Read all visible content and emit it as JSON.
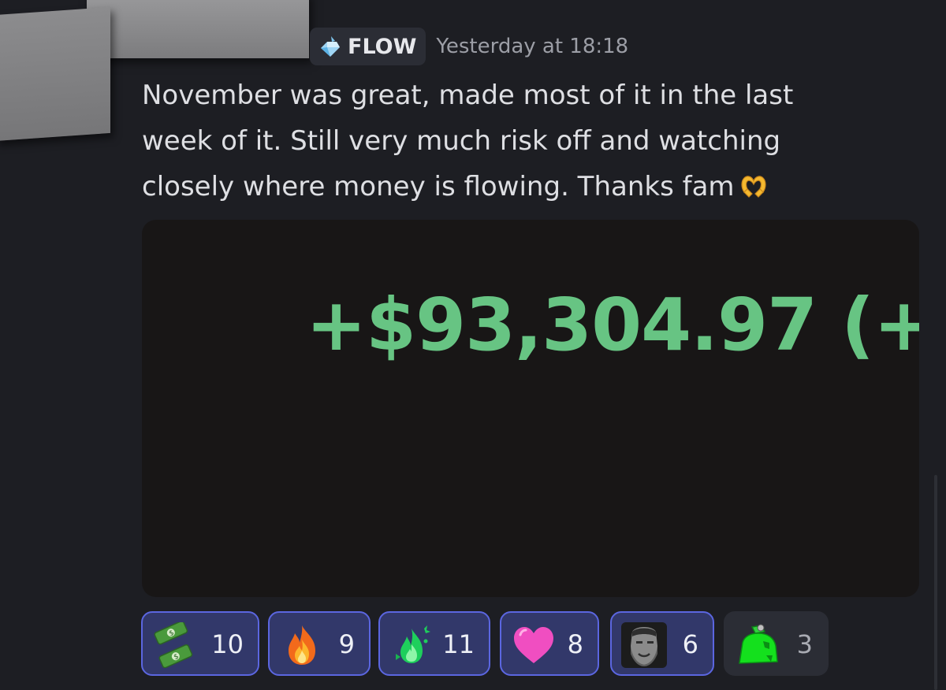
{
  "message": {
    "author_role": "FLOW",
    "role_icon": "blue-diamond-icon",
    "timestamp": "Yesterday at 18:18",
    "lines": [
      "November was great, made most of it in the last",
      "week of it. Still very much risk off and watching",
      "closely where money is flowing. Thanks fam"
    ],
    "trailing_emoji": "heart-hands-icon"
  },
  "attachment": {
    "pnl_text": "+$93,304.97 (+",
    "text_color": "#67c483"
  },
  "reactions": [
    {
      "emoji": "money-wings-icon",
      "count": "10",
      "reacted": true
    },
    {
      "emoji": "fire-icon",
      "count": "9",
      "reacted": true
    },
    {
      "emoji": "green-flame-icon",
      "count": "11",
      "reacted": true
    },
    {
      "emoji": "pink-heart-icon",
      "count": "8",
      "reacted": true
    },
    {
      "emoji": "gigachad-icon",
      "count": "6",
      "reacted": true
    },
    {
      "emoji": "green-money-bag-icon",
      "count": "3",
      "reacted": false
    }
  ],
  "colors": {
    "background": "#1d1e23",
    "reacted_border": "#5b66e0",
    "reacted_fill": "#32386a"
  }
}
